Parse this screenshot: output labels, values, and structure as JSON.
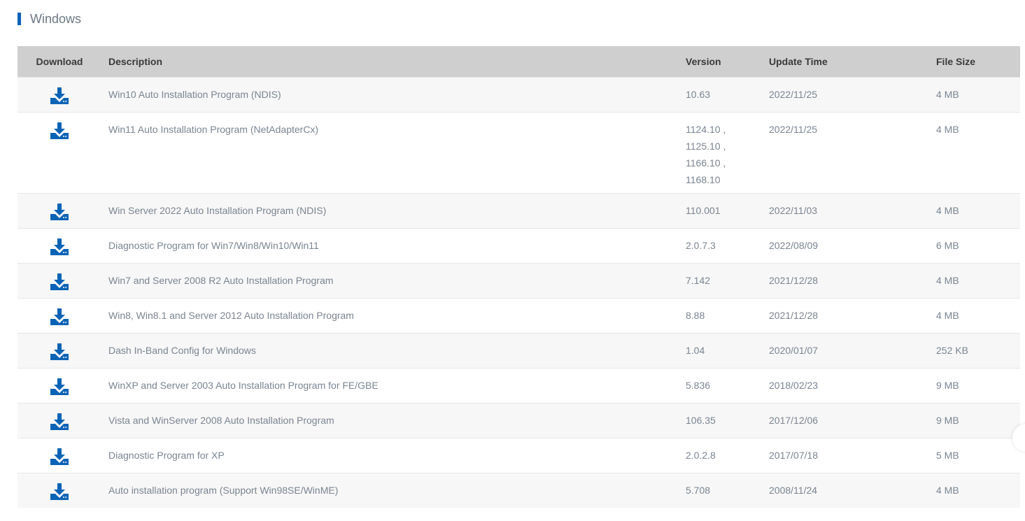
{
  "section": {
    "title": "Windows"
  },
  "table": {
    "headers": {
      "download": "Download",
      "description": "Description",
      "version": "Version",
      "update_time": "Update Time",
      "file_size": "File Size"
    },
    "rows": [
      {
        "description": "Win10 Auto Installation Program (NDIS)",
        "version": [
          "10.63"
        ],
        "update_time": "2022/11/25",
        "file_size": "4 MB"
      },
      {
        "description": "Win11 Auto Installation Program (NetAdapterCx)",
        "version": [
          "1124.10 ,",
          "1125.10 ,",
          "1166.10 ,",
          "1168.10"
        ],
        "update_time": "2022/11/25",
        "file_size": "4 MB"
      },
      {
        "description": "Win Server 2022 Auto Installation Program (NDIS)",
        "version": [
          "110.001"
        ],
        "update_time": "2022/11/03",
        "file_size": "4 MB"
      },
      {
        "description": "Diagnostic Program for Win7/Win8/Win10/Win11",
        "version": [
          "2.0.7.3"
        ],
        "update_time": "2022/08/09",
        "file_size": "6 MB"
      },
      {
        "description": "Win7 and Server 2008 R2 Auto Installation Program",
        "version": [
          "7.142"
        ],
        "update_time": "2021/12/28",
        "file_size": "4 MB"
      },
      {
        "description": "Win8, Win8.1 and Server 2012 Auto Installation Program",
        "version": [
          "8.88"
        ],
        "update_time": "2021/12/28",
        "file_size": "4 MB"
      },
      {
        "description": "Dash In-Band Config for Windows",
        "version": [
          "1.04"
        ],
        "update_time": "2020/01/07",
        "file_size": "252 KB"
      },
      {
        "description": "WinXP and Server 2003 Auto Installation Program for FE/GBE",
        "version": [
          "5.836"
        ],
        "update_time": "2018/02/23",
        "file_size": "9 MB"
      },
      {
        "description": "Vista and WinServer 2008 Auto Installation Program",
        "version": [
          "106.35"
        ],
        "update_time": "2017/12/06",
        "file_size": "9 MB"
      },
      {
        "description": "Diagnostic Program for XP",
        "version": [
          "2.0.2.8"
        ],
        "update_time": "2017/07/18",
        "file_size": "5 MB"
      },
      {
        "description": "Auto installation program (Support Win98SE/WinME)",
        "version": [
          "5.708"
        ],
        "update_time": "2008/11/24",
        "file_size": "4 MB"
      }
    ]
  },
  "icons": {
    "download": "download-icon"
  },
  "colors": {
    "accent": "#0b63b6",
    "header_bg": "#cfcfcf",
    "text": "#7a8491"
  }
}
